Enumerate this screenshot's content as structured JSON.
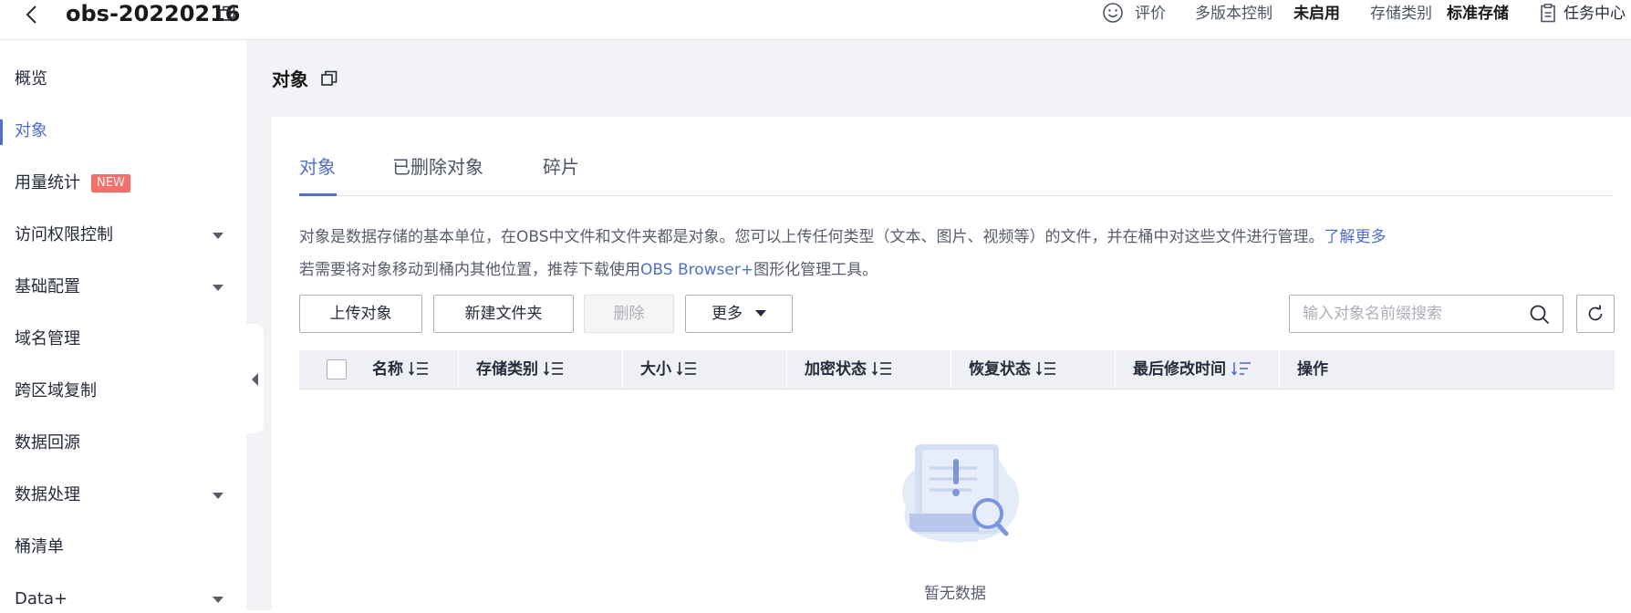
{
  "header": {
    "bucket_name": "obs-20220216",
    "rate_label": "评价",
    "versioning_label": "多版本控制",
    "versioning_value": "未启用",
    "storage_class_label": "存储类别",
    "storage_class_value": "标准存储",
    "task_center_label": "任务中心"
  },
  "sidebar": {
    "items": [
      {
        "label": "概览"
      },
      {
        "label": "对象"
      },
      {
        "label": "用量统计",
        "badge": "NEW"
      },
      {
        "label": "访问权限控制"
      },
      {
        "label": "基础配置"
      },
      {
        "label": "域名管理"
      },
      {
        "label": "跨区域复制"
      },
      {
        "label": "数据回源"
      },
      {
        "label": "数据处理"
      },
      {
        "label": "桶清单"
      },
      {
        "label": "Data+"
      }
    ],
    "active_index": 1
  },
  "main": {
    "title": "对象",
    "tabs": [
      {
        "label": "对象"
      },
      {
        "label": "已删除对象"
      },
      {
        "label": "碎片"
      }
    ],
    "description_line1": "对象是数据存储的基本单位，在OBS中文件和文件夹都是对象。您可以上传任何类型（文本、图片、视频等）的文件，并在桶中对这些文件进行管理。",
    "learn_more": "了解更多",
    "description_line2_prefix": "若需要将对象移动到桶内其他位置，推荐下载使用",
    "obs_browser_link": "OBS Browser+",
    "description_line2_suffix": "图形化管理工具。",
    "toolbar": {
      "upload": "上传对象",
      "new_folder": "新建文件夹",
      "delete": "删除",
      "more": "更多"
    },
    "search": {
      "placeholder": "输入对象名前缀搜索",
      "value": ""
    },
    "table": {
      "columns": [
        {
          "label": "名称"
        },
        {
          "label": "存储类别"
        },
        {
          "label": "大小"
        },
        {
          "label": "加密状态"
        },
        {
          "label": "恢复状态"
        },
        {
          "label": "最后修改时间"
        },
        {
          "label": "操作"
        }
      ],
      "rows": []
    },
    "empty_text": "暂无数据"
  },
  "colors": {
    "accent": "#526ecc",
    "badge_new": "#f66f6a",
    "page_bg": "#f1f3f6",
    "table_header_bg": "#eef0f5"
  },
  "icons": [
    "back-arrow-icon",
    "copy-icon",
    "smile-icon",
    "task-list-icon",
    "chevron-down-icon",
    "collapse-arrow-icon",
    "sort-icon",
    "search-icon",
    "refresh-icon",
    "empty-state-icon"
  ]
}
